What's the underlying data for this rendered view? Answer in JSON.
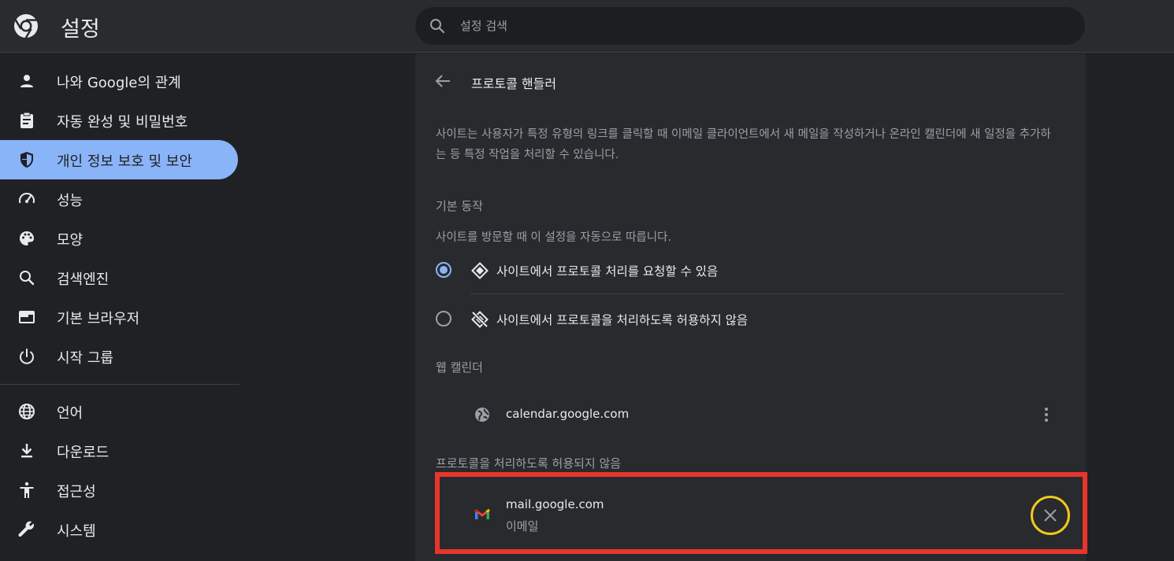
{
  "header": {
    "title": "설정",
    "search_placeholder": "설정 검색"
  },
  "sidebar": {
    "items": [
      {
        "label": "나와 Google의 관계",
        "icon": "person-icon"
      },
      {
        "label": "자동 완성 및 비밀번호",
        "icon": "clipboard-icon"
      },
      {
        "label": "개인 정보 보호 및 보안",
        "icon": "shield-icon",
        "active": true
      },
      {
        "label": "성능",
        "icon": "speedometer-icon"
      },
      {
        "label": "모양",
        "icon": "palette-icon"
      },
      {
        "label": "검색엔진",
        "icon": "search-icon"
      },
      {
        "label": "기본 브라우저",
        "icon": "browser-icon"
      },
      {
        "label": "시작 그룹",
        "icon": "power-icon"
      },
      {
        "label": "언어",
        "icon": "globe-icon"
      },
      {
        "label": "다운로드",
        "icon": "download-icon"
      },
      {
        "label": "접근성",
        "icon": "accessibility-icon"
      },
      {
        "label": "시스템",
        "icon": "wrench-icon"
      }
    ]
  },
  "main": {
    "title": "프로토콜 핸들러",
    "description": "사이트는 사용자가 특정 유형의 링크를 클릭할 때 이메일 클라이언트에서 새 메일을 작성하거나 온라인 캘린더에 새 일정을 추가하는 등 특정 작업을 처리할 수 있습니다.",
    "default_behavior": {
      "heading": "기본 동작",
      "subtext": "사이트를 방문할 때 이 설정을 자동으로 따릅니다.",
      "options": [
        {
          "label": "사이트에서 프로토콜 처리를 요청할 수 있음",
          "checked": true
        },
        {
          "label": "사이트에서 프로토콜을 처리하도록 허용하지 않음",
          "checked": false
        }
      ]
    },
    "web_calendar": {
      "heading": "웹 캘린더",
      "site": "calendar.google.com"
    },
    "blocked": {
      "heading": "프로토콜을 처리하도록 허용되지 않음",
      "site": "mail.google.com",
      "protocol": "이메일"
    }
  },
  "colors": {
    "accent": "#8ab4f8",
    "highlight_box": "#e8352b",
    "highlight_circle": "#f2c91c"
  }
}
